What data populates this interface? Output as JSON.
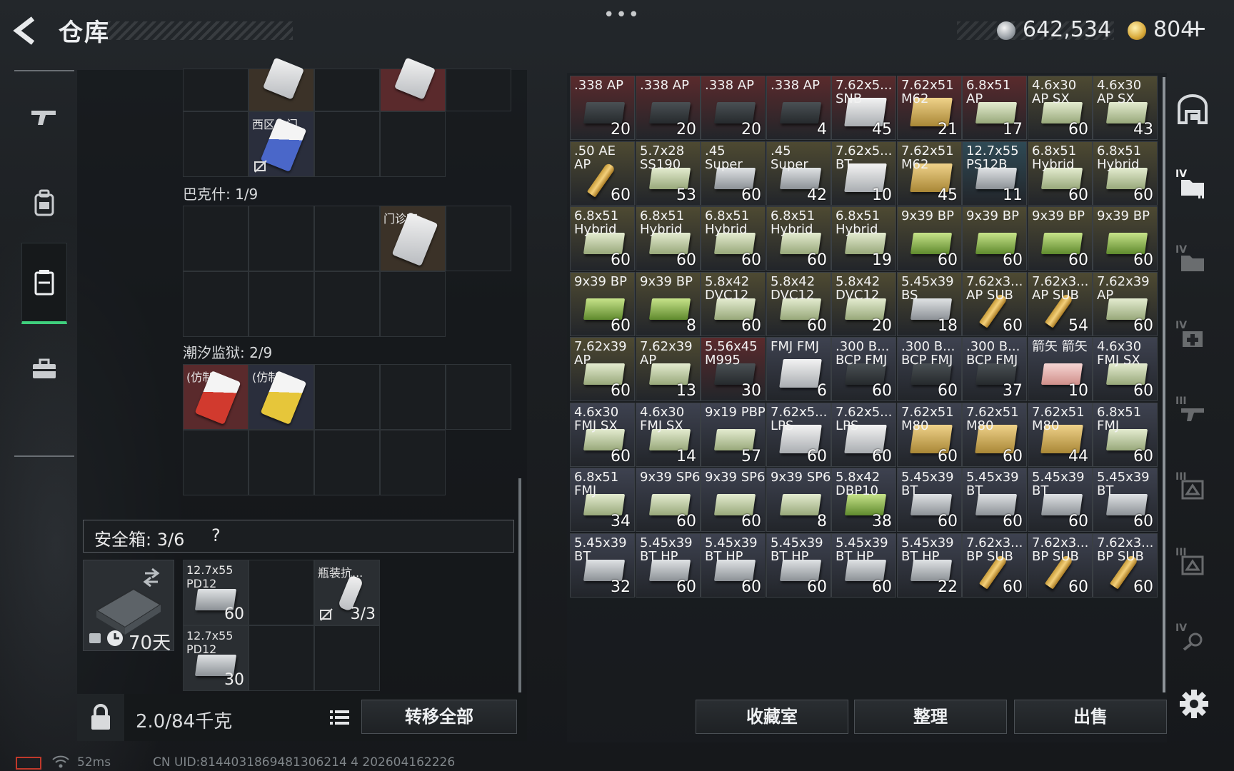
{
  "header": {
    "title": "仓库",
    "menu_dots": "•••",
    "balance_silver": "642,534",
    "balance_gold": "804",
    "plus": "+"
  },
  "sidebar": {
    "items": [
      {
        "icon": "gun-icon"
      },
      {
        "icon": "backpack-icon"
      },
      {
        "icon": "storage-icon",
        "active": true
      },
      {
        "icon": "briefcase-icon"
      }
    ]
  },
  "left_sections": {
    "west_top": {
      "card_label": "西区大门"
    },
    "bakshi": {
      "label": "巴克什: 1/9",
      "card_label": "门诊室"
    },
    "tidal_prison": {
      "label": "潮汐监狱: 2/9",
      "card1_label": "(仿制)...",
      "card2_label": "(仿制)..."
    }
  },
  "safe_box": {
    "title": "安全箱: 3/6",
    "help": "?",
    "days": "70天",
    "items": [
      {
        "name": "12.7x55 PD12",
        "qty": "60"
      },
      {
        "name": "瓶装抗...",
        "qty": "3/3"
      },
      {
        "name": "12.7x55 PD12",
        "qty": "30"
      }
    ]
  },
  "bottom_left": {
    "weight": "2.0/84千克",
    "transfer_all": "转移全部"
  },
  "grid": {
    "rows": [
      [
        {
          "name": ".338 AP",
          "qty": "20",
          "bg": "#5a2a2c",
          "box": "dark"
        },
        {
          "name": ".338 AP",
          "qty": "20",
          "bg": "#5a2a2c",
          "box": "dark"
        },
        {
          "name": ".338 AP",
          "qty": "20",
          "bg": "#5a2a2c",
          "box": "dark"
        },
        {
          "name": ".338 AP",
          "qty": "4",
          "bg": "#5a2a2c",
          "box": "dark"
        },
        {
          "name": "7.62x5... SNB",
          "qty": "45",
          "bg": "#5a2a2c",
          "box": "white"
        },
        {
          "name": "7.62x51 M62",
          "qty": "21",
          "bg": "#5a2a2c",
          "box": "tan"
        },
        {
          "name": "6.8x51 AP",
          "qty": "17",
          "bg": "#5a2a2c",
          "box": "ltgreen"
        },
        {
          "name": "4.6x30 AP SX",
          "qty": "60",
          "bg": "#4e4a32",
          "box": "ltgreen"
        },
        {
          "name": "4.6x30 AP SX",
          "qty": "43",
          "bg": "#4e4a32",
          "box": "ltgreen"
        }
      ],
      [
        {
          "name": ".50 AE AP",
          "qty": "60",
          "bg": "#4e4a32",
          "box": "bullet"
        },
        {
          "name": "5.7x28 SS190",
          "qty": "53",
          "bg": "#4e4a32",
          "box": "ltgreen"
        },
        {
          "name": ".45 Super",
          "qty": "60",
          "bg": "#4e4a32",
          "box": "gray"
        },
        {
          "name": ".45 Super",
          "qty": "42",
          "bg": "#4e4a32",
          "box": "gray"
        },
        {
          "name": "7.62x5... BT",
          "qty": "10",
          "bg": "#4e4a32",
          "box": "white"
        },
        {
          "name": "7.62x51 M62",
          "qty": "45",
          "bg": "#4e4a32",
          "box": "tan"
        },
        {
          "name": "12.7x55 PS12B",
          "qty": "11",
          "bg": "#2f4a55",
          "box": "gray"
        },
        {
          "name": "6.8x51 Hybrid",
          "qty": "60",
          "bg": "#4e4a32",
          "box": "ltgreen"
        },
        {
          "name": "6.8x51 Hybrid",
          "qty": "60",
          "bg": "#4e4a32",
          "box": "ltgreen"
        }
      ],
      [
        {
          "name": "6.8x51 Hybrid",
          "qty": "60",
          "bg": "#4e4a32",
          "box": "ltgreen"
        },
        {
          "name": "6.8x51 Hybrid",
          "qty": "60",
          "bg": "#4e4a32",
          "box": "ltgreen"
        },
        {
          "name": "6.8x51 Hybrid",
          "qty": "60",
          "bg": "#4e4a32",
          "box": "ltgreen"
        },
        {
          "name": "6.8x51 Hybrid",
          "qty": "60",
          "bg": "#4e4a32",
          "box": "ltgreen"
        },
        {
          "name": "6.8x51 Hybrid",
          "qty": "19",
          "bg": "#4e4a32",
          "box": "ltgreen"
        },
        {
          "name": "9x39 BP",
          "qty": "60",
          "bg": "#4e4a32",
          "box": "green"
        },
        {
          "name": "9x39 BP",
          "qty": "60",
          "bg": "#4e4a32",
          "box": "green"
        },
        {
          "name": "9x39 BP",
          "qty": "60",
          "bg": "#4e4a32",
          "box": "green"
        },
        {
          "name": "9x39 BP",
          "qty": "60",
          "bg": "#4e4a32",
          "box": "green"
        }
      ],
      [
        {
          "name": "9x39 BP",
          "qty": "60",
          "bg": "#4e4a32",
          "box": "green"
        },
        {
          "name": "9x39 BP",
          "qty": "8",
          "bg": "#4e4a32",
          "box": "green"
        },
        {
          "name": "5.8x42 DVC12",
          "qty": "60",
          "bg": "#4e4a32",
          "box": "ltgreen"
        },
        {
          "name": "5.8x42 DVC12",
          "qty": "60",
          "bg": "#4e4a32",
          "box": "ltgreen"
        },
        {
          "name": "5.8x42 DVC12",
          "qty": "20",
          "bg": "#4e4a32",
          "box": "ltgreen"
        },
        {
          "name": "5.45x39 BS",
          "qty": "18",
          "bg": "#4e4a32",
          "box": "gray"
        },
        {
          "name": "7.62x3... AP SUB",
          "qty": "60",
          "bg": "#4e4a32",
          "box": "bullet"
        },
        {
          "name": "7.62x3... AP SUB",
          "qty": "54",
          "bg": "#4e4a32",
          "box": "bullet"
        },
        {
          "name": "7.62x39 AP",
          "qty": "60",
          "bg": "#4e4a32",
          "box": "ltgreen"
        }
      ],
      [
        {
          "name": "7.62x39 AP",
          "qty": "60",
          "bg": "#4e4a32",
          "box": "ltgreen"
        },
        {
          "name": "7.62x39 AP",
          "qty": "13",
          "bg": "#4e4a32",
          "box": "ltgreen"
        },
        {
          "name": "5.56x45 M995",
          "qty": "30",
          "bg": "#5a2a2c",
          "box": "dark"
        },
        {
          "name": "FMJ FMJ",
          "qty": "6",
          "bg": "#3e4250",
          "box": "white"
        },
        {
          "name": ".300 B... BCP FMJ",
          "qty": "60",
          "bg": "#3e4250",
          "box": "dark"
        },
        {
          "name": ".300 B... BCP FMJ",
          "qty": "60",
          "bg": "#3e4250",
          "box": "dark"
        },
        {
          "name": ".300 B... BCP FMJ",
          "qty": "37",
          "bg": "#3e4250",
          "box": "dark"
        },
        {
          "name": "箭矢 箭矢",
          "qty": "10",
          "bg": "#3e4250",
          "box": "pink"
        },
        {
          "name": "4.6x30 FMJ SX",
          "qty": "60",
          "bg": "#3e4250",
          "box": "ltgreen"
        }
      ],
      [
        {
          "name": "4.6x30 FMJ SX",
          "qty": "60",
          "bg": "#3e4250",
          "box": "ltgreen"
        },
        {
          "name": "4.6x30 FMJ SX",
          "qty": "14",
          "bg": "#3e4250",
          "box": "ltgreen"
        },
        {
          "name": "9x19 PBP",
          "qty": "57",
          "bg": "#3e4250",
          "box": "ltgreen"
        },
        {
          "name": "7.62x5... LPS",
          "qty": "60",
          "bg": "#3e4250",
          "box": "white"
        },
        {
          "name": "7.62x5... LPS",
          "qty": "60",
          "bg": "#3e4250",
          "box": "white"
        },
        {
          "name": "7.62x51 M80",
          "qty": "60",
          "bg": "#3e4250",
          "box": "tan"
        },
        {
          "name": "7.62x51 M80",
          "qty": "60",
          "bg": "#3e4250",
          "box": "tan"
        },
        {
          "name": "7.62x51 M80",
          "qty": "44",
          "bg": "#3e4250",
          "box": "tan"
        },
        {
          "name": "6.8x51 FMJ",
          "qty": "60",
          "bg": "#3e4250",
          "box": "ltgreen"
        }
      ],
      [
        {
          "name": "6.8x51 FMJ",
          "qty": "34",
          "bg": "#3e4250",
          "box": "ltgreen"
        },
        {
          "name": "9x39 SP6",
          "qty": "60",
          "bg": "#3e4250",
          "box": "ltgreen"
        },
        {
          "name": "9x39 SP6",
          "qty": "60",
          "bg": "#3e4250",
          "box": "ltgreen"
        },
        {
          "name": "9x39 SP6",
          "qty": "8",
          "bg": "#3e4250",
          "box": "ltgreen"
        },
        {
          "name": "5.8x42 DBP10",
          "qty": "38",
          "bg": "#3e4250",
          "box": "green"
        },
        {
          "name": "5.45x39 BT",
          "qty": "60",
          "bg": "#3e4250",
          "box": "gray"
        },
        {
          "name": "5.45x39 BT",
          "qty": "60",
          "bg": "#3e4250",
          "box": "gray"
        },
        {
          "name": "5.45x39 BT",
          "qty": "60",
          "bg": "#3e4250",
          "box": "gray"
        },
        {
          "name": "5.45x39 BT",
          "qty": "60",
          "bg": "#3e4250",
          "box": "gray"
        }
      ],
      [
        {
          "name": "5.45x39 BT",
          "qty": "32",
          "bg": "#3e4250",
          "box": "gray"
        },
        {
          "name": "5.45x39 BT HP",
          "qty": "60",
          "bg": "#3e4250",
          "box": "gray"
        },
        {
          "name": "5.45x39 BT HP",
          "qty": "60",
          "bg": "#3e4250",
          "box": "gray"
        },
        {
          "name": "5.45x39 BT HP",
          "qty": "60",
          "bg": "#3e4250",
          "box": "gray"
        },
        {
          "name": "5.45x39 BT HP",
          "qty": "60",
          "bg": "#3e4250",
          "box": "gray"
        },
        {
          "name": "5.45x39 BT HP",
          "qty": "22",
          "bg": "#3e4250",
          "box": "gray"
        },
        {
          "name": "7.62x3... BP SUB",
          "qty": "60",
          "bg": "#3e4250",
          "box": "bullet"
        },
        {
          "name": "7.62x3... BP SUB",
          "qty": "60",
          "bg": "#3e4250",
          "box": "bullet"
        },
        {
          "name": "7.62x3... BP SUB",
          "qty": "60",
          "bg": "#3e4250",
          "box": "bullet"
        }
      ]
    ]
  },
  "right_buttons": {
    "collection": "收藏室",
    "sort": "整理",
    "sell": "出售"
  },
  "right_tabs": [
    {
      "icon": "home-gate-icon"
    },
    {
      "icon": "tier-iv-folder-icon",
      "label": "IV"
    },
    {
      "icon": "tier-iv-folder-icon",
      "label": "IV"
    },
    {
      "icon": "tier-iv-medkit-icon",
      "label": "IV"
    },
    {
      "icon": "tier-iii-gun-icon",
      "label": "III"
    },
    {
      "icon": "tier-iii-box-icon",
      "label": "III"
    },
    {
      "icon": "tier-iii-box-icon",
      "label": "III"
    },
    {
      "icon": "tier-iv-tool-icon",
      "label": "IV"
    }
  ],
  "footer": {
    "ping": "52ms",
    "uid": "CN UID:8144031869481306214 4 202604162226"
  },
  "colors": {
    "accent_green": "#3fcf7d",
    "red_slot": "#5a2a2c",
    "gold_slot": "#4e4a32",
    "blue_slot": "#3e4250"
  }
}
